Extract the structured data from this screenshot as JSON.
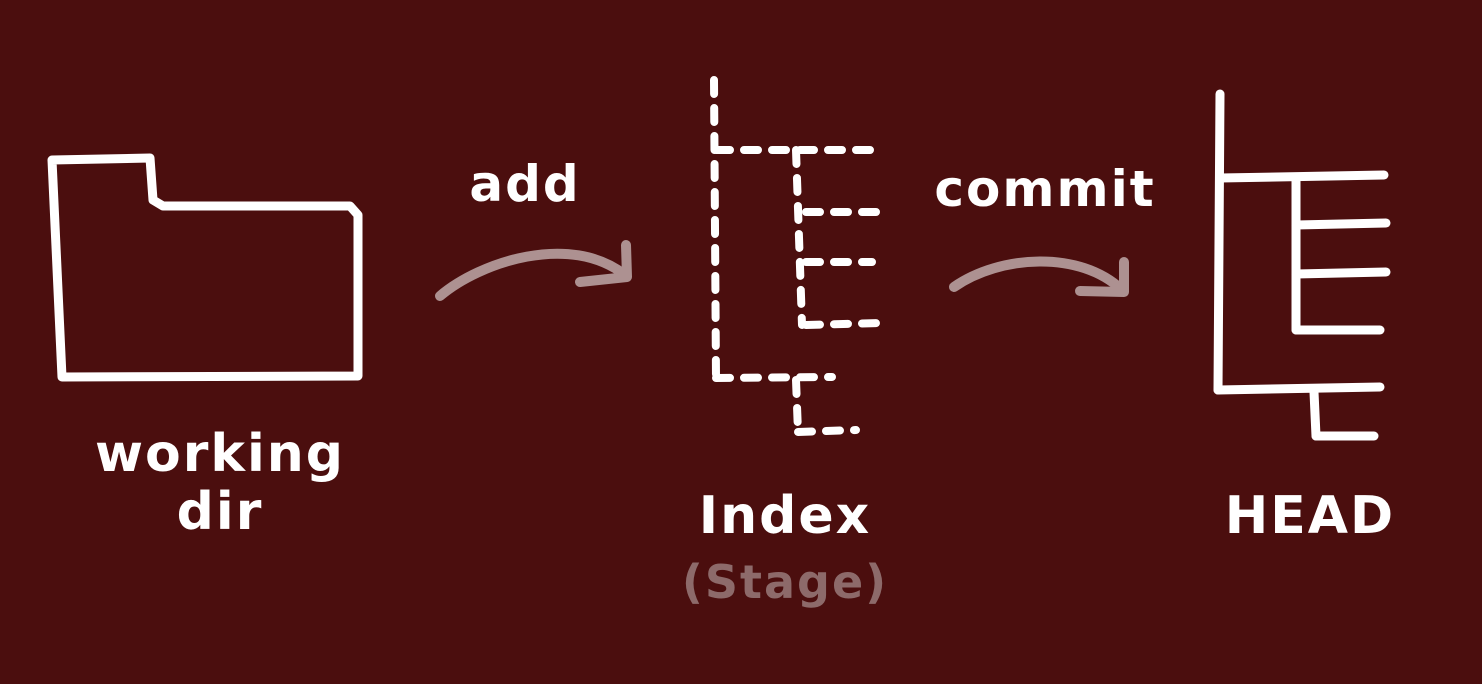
{
  "colors": {
    "background": "#4b0e0e",
    "stroke": "#ffffff",
    "arrow": "#ad9191",
    "sublabel": "#8d6a6a"
  },
  "nodes": {
    "working_dir": {
      "line1": "working",
      "line2": "dir",
      "icon": "folder-icon"
    },
    "index": {
      "label": "Index",
      "sublabel": "(Stage)",
      "icon": "dashed-tree-icon"
    },
    "head": {
      "label": "HEAD",
      "icon": "tree-icon"
    }
  },
  "actions": {
    "add": {
      "label": "add"
    },
    "commit": {
      "label": "commit"
    }
  }
}
